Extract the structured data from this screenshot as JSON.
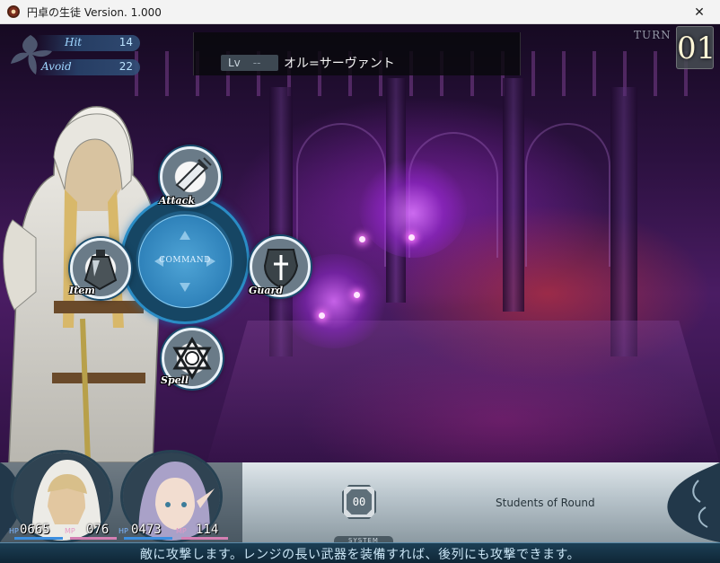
{
  "window": {
    "title": "円卓の生徒 Version. 1.000",
    "close_symbol": "✕",
    "app_icon": "round-table-icon"
  },
  "stats": {
    "hit": {
      "label": "Hit",
      "value": "14"
    },
    "avoid": {
      "label": "Avoid",
      "value": "22"
    }
  },
  "target": {
    "lv_label": "Lv",
    "lv_value": "--",
    "name": "オル=サーヴァント"
  },
  "turn": {
    "label": "TURN",
    "value": "01"
  },
  "command_wheel": {
    "center_label": "COMMAND",
    "commands": {
      "attack": "Attack",
      "item": "Item",
      "guard": "Guard",
      "spell": "Spell"
    }
  },
  "party": {
    "name": "Students of Round",
    "turn_order": "00",
    "system_label": "SYSTEM",
    "members": [
      {
        "hp_tag": "HP",
        "hp": "0665",
        "mp_tag": "MP",
        "mp": "076"
      },
      {
        "hp_tag": "HP",
        "hp": "0473",
        "mp_tag": "MP",
        "mp": "114"
      }
    ]
  },
  "help_text": "敵に攻撃します。レンジの長い武器を装備すれば、後列にも攻撃できます。",
  "colors": {
    "accent_blue": "#2a8dc6",
    "hp_bar": "#3c8fe0",
    "mp_bar": "#d47fb3",
    "scene_purple": "#4a1c63"
  }
}
